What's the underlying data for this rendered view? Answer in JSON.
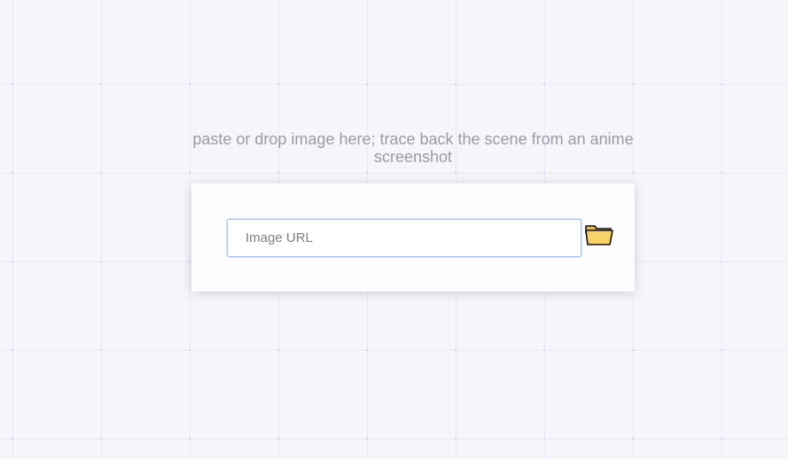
{
  "hint": {
    "text": "paste or drop image here; trace back the scene from an anime screenshot"
  },
  "search": {
    "placeholder": "Image URL",
    "value": ""
  },
  "file_button": {
    "icon": "folder-icon"
  },
  "colors": {
    "background": "#f5f5fa",
    "card": "#fdfdff",
    "input_border": "#a6c1f3",
    "folder_fill": "#f8d36a",
    "hint_text": "#9b9ba3"
  }
}
